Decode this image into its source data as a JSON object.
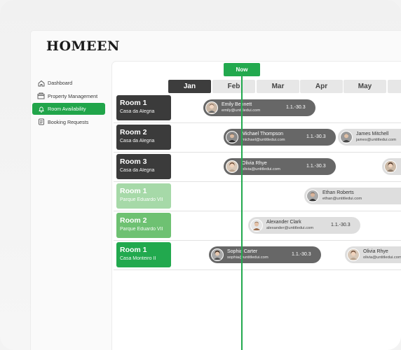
{
  "app": {
    "logo": "HOMEEN"
  },
  "sidebar": {
    "items": [
      {
        "label": "Dashboard",
        "icon": "home-icon",
        "active": false
      },
      {
        "label": "Property Management",
        "icon": "building-icon",
        "active": false
      },
      {
        "label": "Room Availability",
        "icon": "bell-icon",
        "active": true
      },
      {
        "label": "Booking Requests",
        "icon": "list-icon",
        "active": false
      }
    ]
  },
  "timeline": {
    "now_label": "Now",
    "months": [
      "Jan",
      "Feb",
      "Mar",
      "Apr",
      "May",
      ""
    ],
    "active_month": "Jan"
  },
  "rooms": [
    {
      "name": "Room 1",
      "location": "Casa da Alegria",
      "style": "dark"
    },
    {
      "name": "Room 2",
      "location": "Casa da Alegria",
      "style": "dark"
    },
    {
      "name": "Room 3",
      "location": "Casa da Alegria",
      "style": "dark"
    },
    {
      "name": "Room 1",
      "location": "Parque Eduardo VII",
      "style": "light"
    },
    {
      "name": "Room 2",
      "location": "Parque Eduardo VII",
      "style": "mid"
    },
    {
      "name": "Room 1",
      "location": "Casa Monteiro II",
      "style": "green"
    }
  ],
  "bookings": [
    {
      "name": "Emily Bennett",
      "email": "emily@untitledui.com",
      "range": "1.1.-30.3",
      "style": "dark"
    },
    {
      "name": "Michael Thompson",
      "email": "michael@untitledui.com",
      "range": "1.1.-30.3",
      "style": "dark"
    },
    {
      "name": "James Mitchell",
      "email": "james@untitledui.com",
      "range": "",
      "style": "light"
    },
    {
      "name": "Olivia Rhye",
      "email": "olivia@untitledui.com",
      "range": "1.1.-30.3",
      "style": "dark"
    },
    {
      "name": "",
      "email": "",
      "range": "",
      "style": "light"
    },
    {
      "name": "Ethan Roberts",
      "email": "ethan@untitledui.com",
      "range": "",
      "style": "light"
    },
    {
      "name": "Alexander Clark",
      "email": "alexander@untitledui.com",
      "range": "1.1.-30.3",
      "style": "light"
    },
    {
      "name": "Sophia Carter",
      "email": "sophia@untitledui.com",
      "range": "1.1.-30.3",
      "style": "dark"
    },
    {
      "name": "Olivia Rhye",
      "email": "olivia@untitledui.com",
      "range": "",
      "style": "light"
    }
  ],
  "colors": {
    "accent": "#22a94e",
    "dark": "#3b3b3b",
    "pill_dark": "#676767",
    "pill_light": "#dedede"
  }
}
